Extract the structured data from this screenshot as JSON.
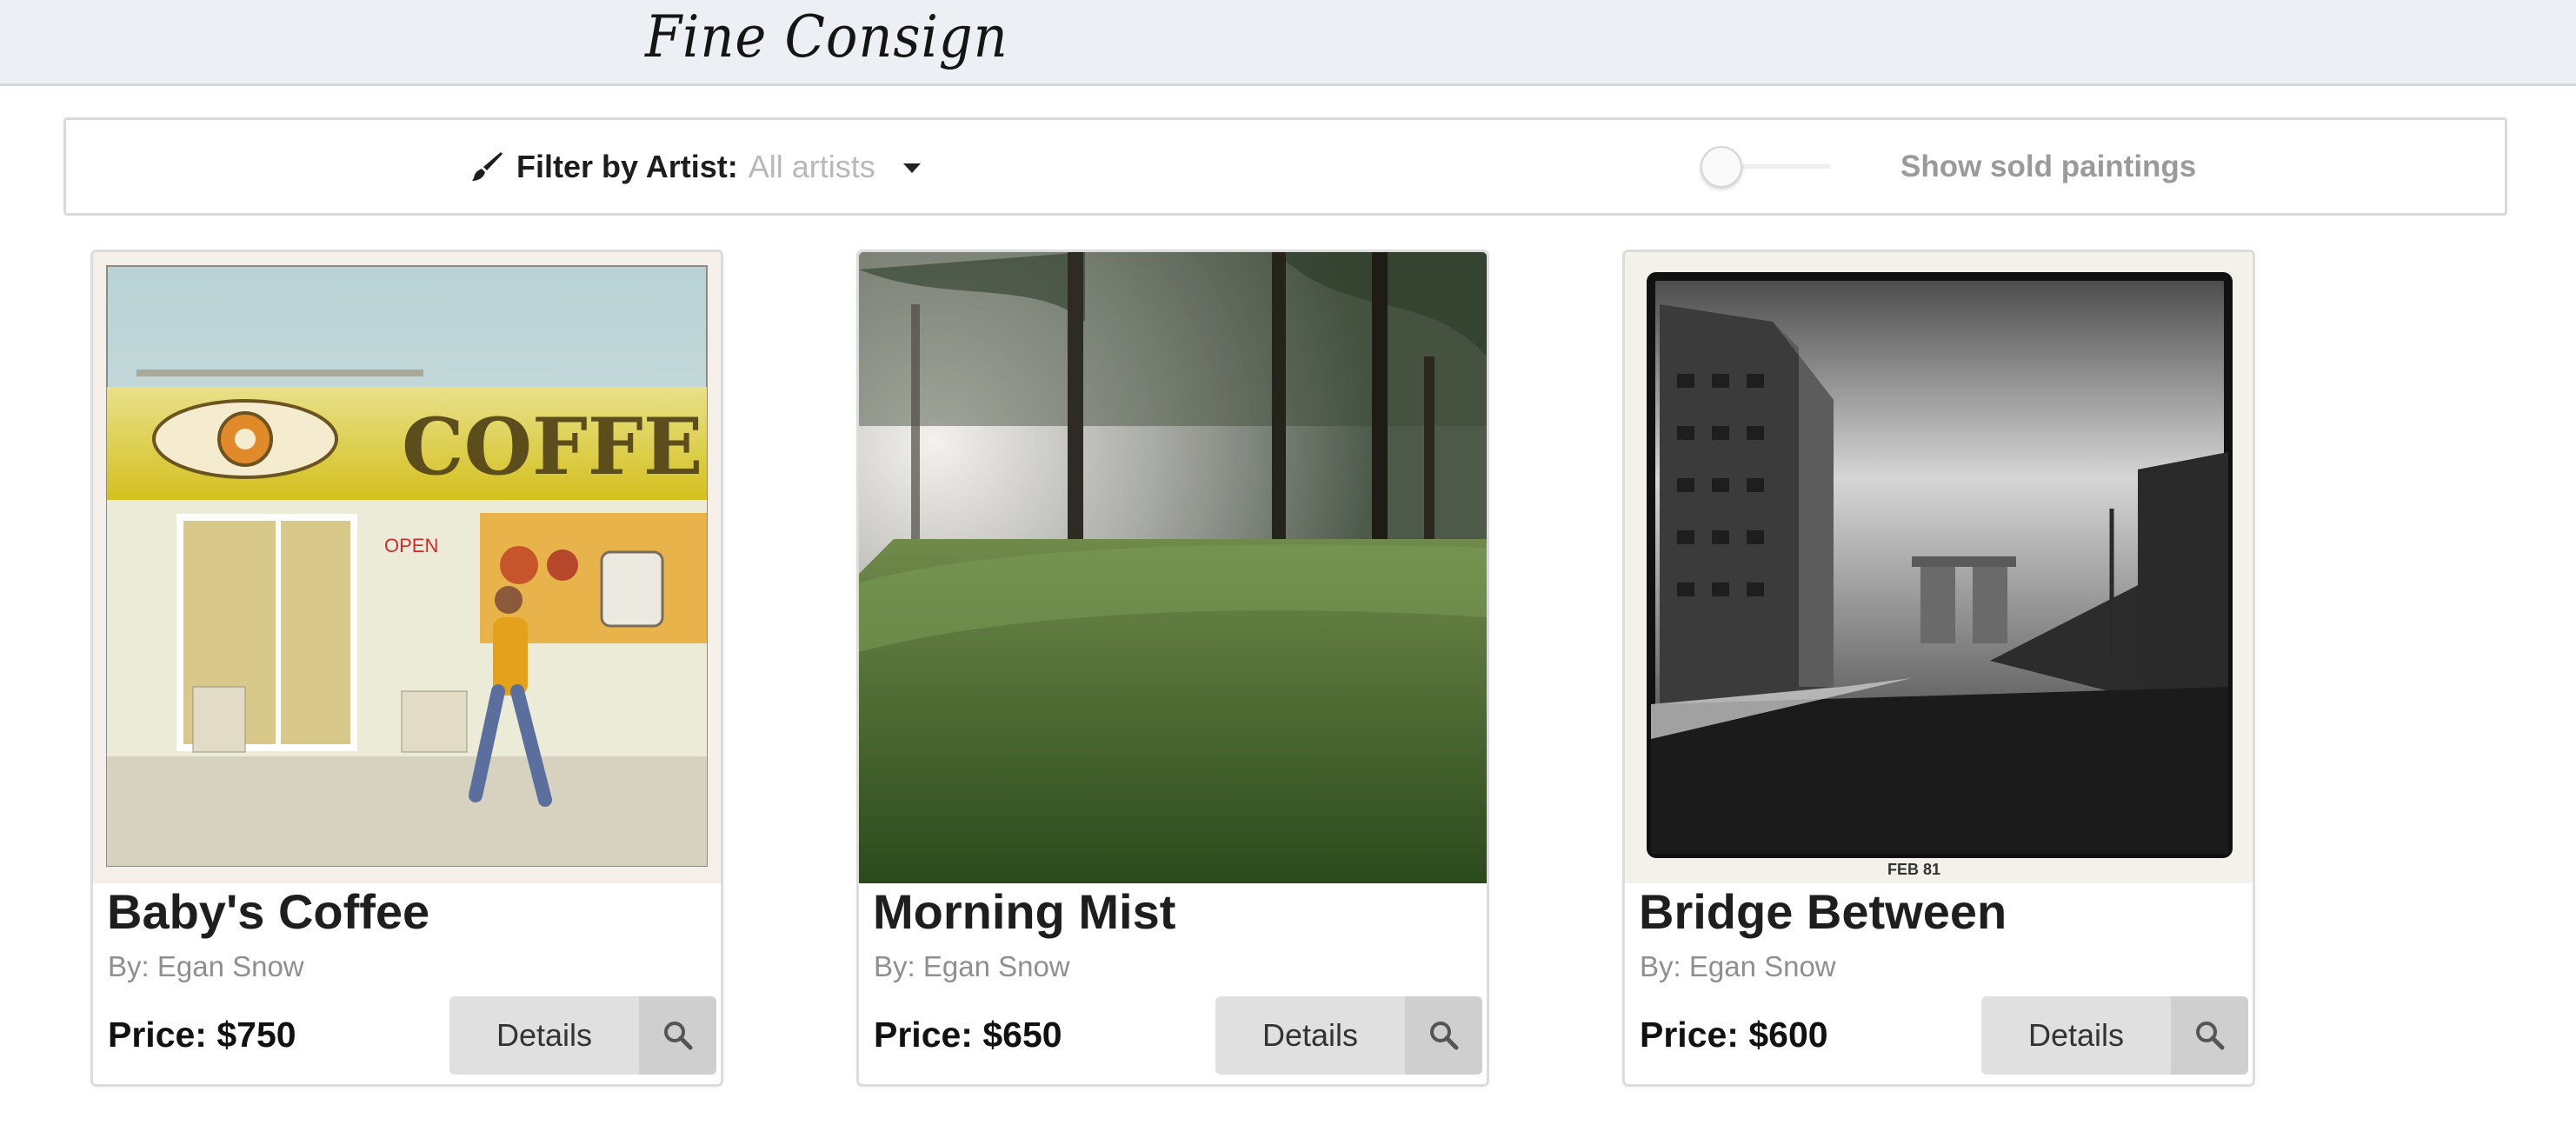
{
  "header": {
    "brand": "Fine Consign"
  },
  "filter": {
    "label": "Filter by Artist:",
    "value": "All artists",
    "sold_toggle_label": "Show sold paintings",
    "sold_toggle_on": false
  },
  "cards": [
    {
      "title": "Baby's Coffee",
      "artist": "By: Egan Snow",
      "price": "Price: $750",
      "details_label": "Details",
      "shop_sign": "COFFE",
      "open_sign": "OPEN"
    },
    {
      "title": "Morning Mist",
      "artist": "By: Egan Snow",
      "price": "Price: $650",
      "details_label": "Details"
    },
    {
      "title": "Bridge Between",
      "artist": "By: Egan Snow",
      "price": "Price: $600",
      "details_label": "Details",
      "photo_date": "FEB  81"
    }
  ],
  "icons": {
    "brush": "paintbrush-icon",
    "caret": "caret-down-icon",
    "search": "search-icon"
  }
}
